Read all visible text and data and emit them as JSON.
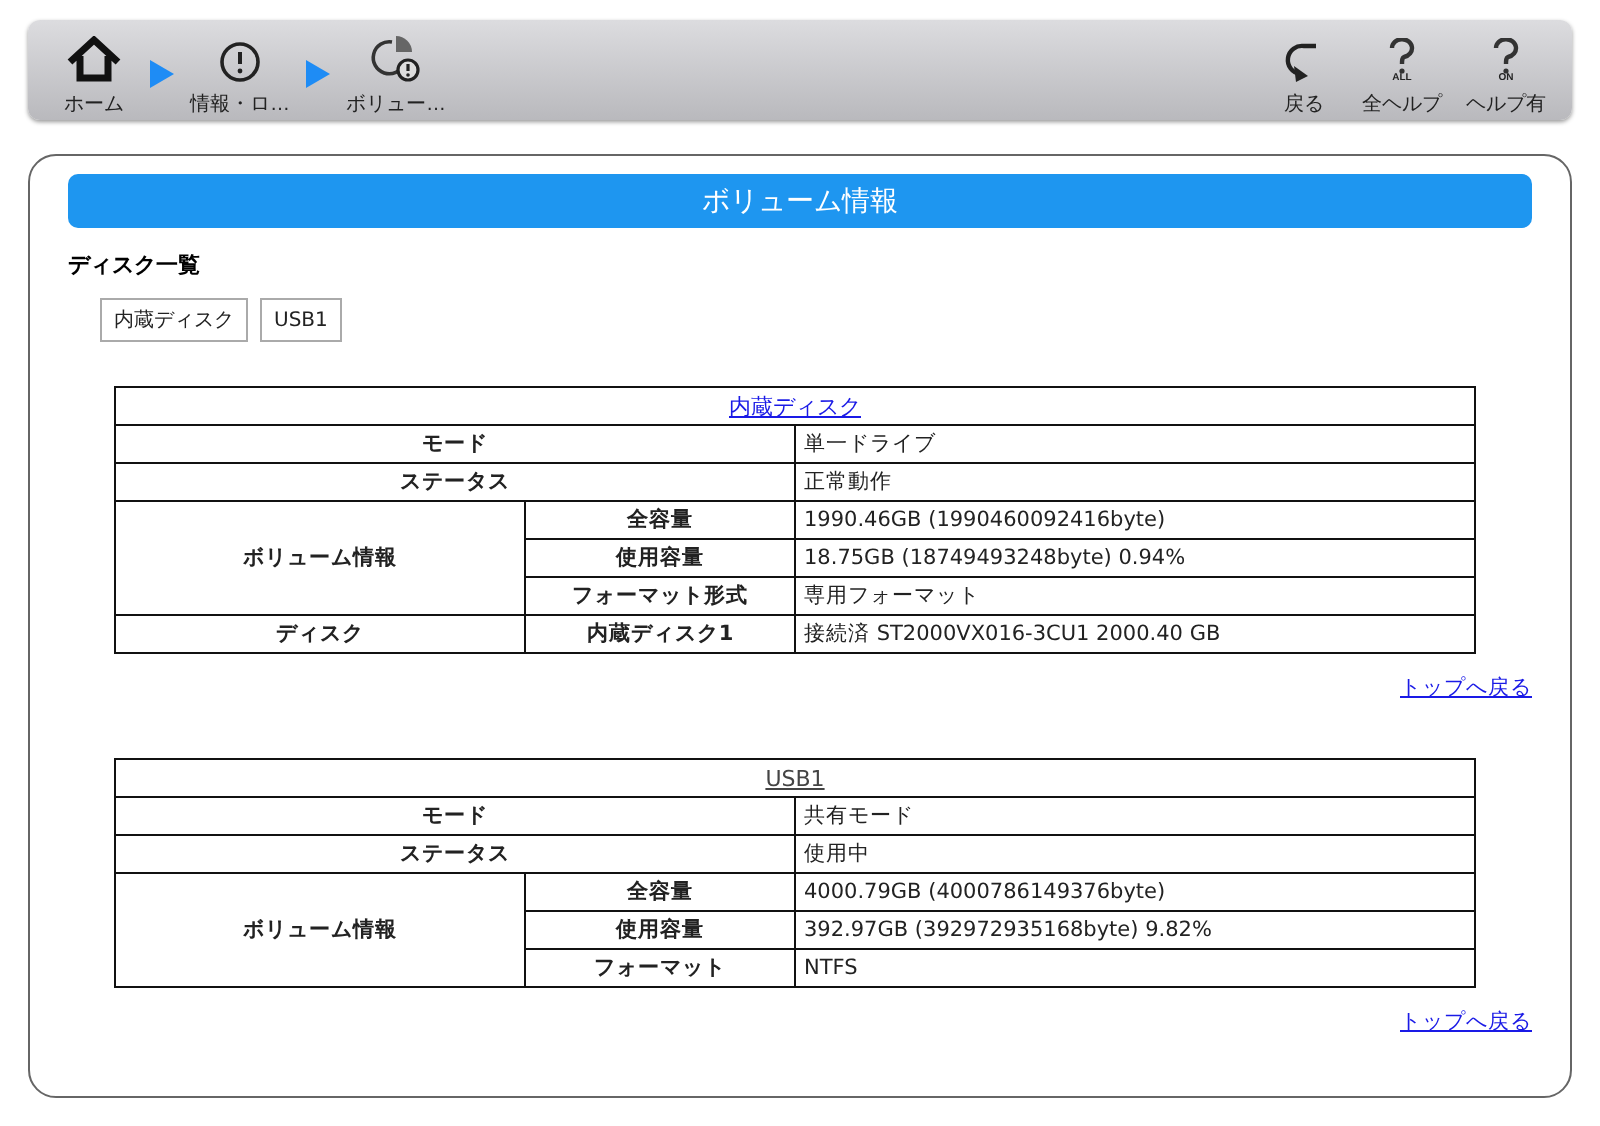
{
  "toolbar": {
    "breadcrumbs": [
      {
        "kind": "home",
        "label": "ホーム"
      },
      {
        "kind": "info",
        "label": "情報・ロ…"
      },
      {
        "kind": "volume",
        "label": "ボリュー…"
      }
    ],
    "actions": [
      {
        "kind": "back",
        "label": "戻る"
      },
      {
        "kind": "help-all",
        "label": "全ヘルプ",
        "badge": "ALL"
      },
      {
        "kind": "help-on",
        "label": "ヘルプ有",
        "badge": "ON"
      }
    ]
  },
  "panel": {
    "title": "ボリューム情報",
    "section_heading": "ディスク一覧",
    "disk_buttons": [
      "内蔵ディスク",
      "USB1"
    ],
    "tables": [
      {
        "title": "内蔵ディスク",
        "visited": false,
        "back_link": "トップへ戻る",
        "rows": [
          {
            "kind": "single",
            "label": "モード",
            "value": "単一ドライブ"
          },
          {
            "kind": "single",
            "label": "ステータス",
            "value": "正常動作"
          },
          {
            "kind": "group",
            "label": "ボリューム情報",
            "items": [
              {
                "label": "全容量",
                "value": "1990.46GB (1990460092416byte)"
              },
              {
                "label": "使用容量",
                "value": "18.75GB (18749493248byte) 0.94%"
              },
              {
                "label": "フォーマット形式",
                "value": "専用フォーマット"
              }
            ]
          },
          {
            "kind": "group",
            "label": "ディスク",
            "items": [
              {
                "label": "内蔵ディスク1",
                "value": "接続済 ST2000VX016-3CU1 2000.40 GB"
              }
            ]
          }
        ]
      },
      {
        "title": "USB1",
        "visited": true,
        "back_link": "トップへ戻る",
        "rows": [
          {
            "kind": "single",
            "label": "モード",
            "value": "共有モード"
          },
          {
            "kind": "single",
            "label": "ステータス",
            "value": "使用中"
          },
          {
            "kind": "group",
            "label": "ボリューム情報",
            "items": [
              {
                "label": "全容量",
                "value": "4000.79GB (4000786149376byte)"
              },
              {
                "label": "使用容量",
                "value": "392.97GB (392972935168byte) 9.82%"
              },
              {
                "label": "フォーマット",
                "value": "NTFS"
              }
            ]
          }
        ]
      }
    ]
  }
}
